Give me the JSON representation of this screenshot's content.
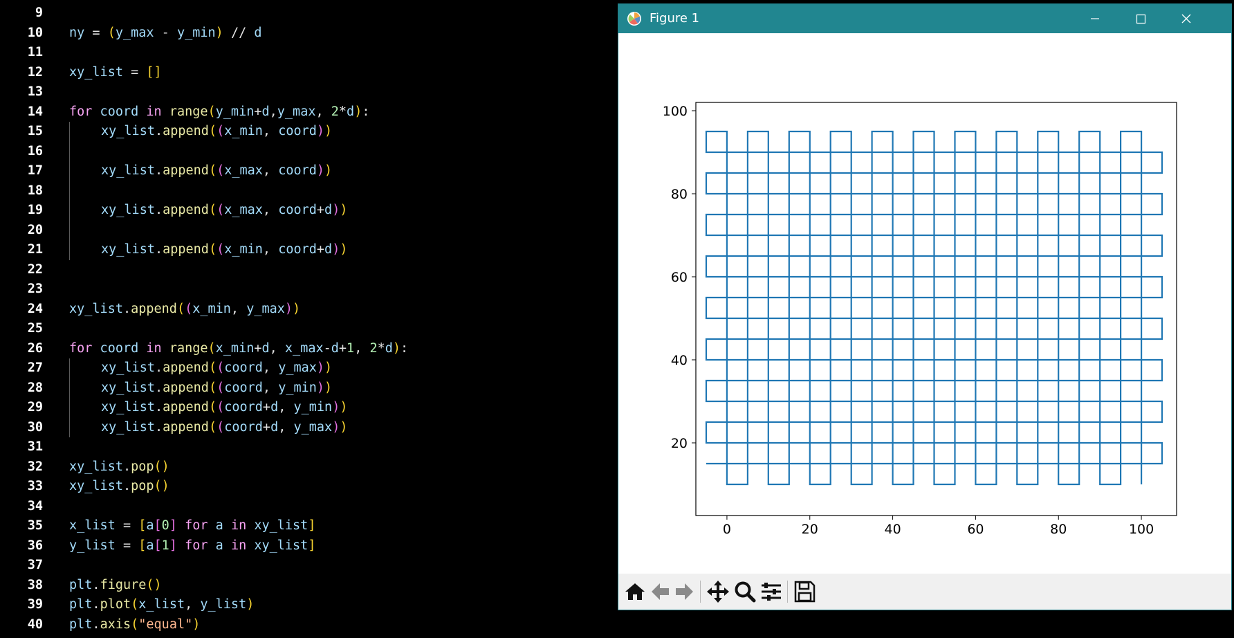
{
  "editor": {
    "lines": [
      {
        "n": "9",
        "indent": 0,
        "tokens": []
      },
      {
        "n": "10",
        "indent": 0,
        "tokens": [
          [
            "ny",
            "var"
          ],
          [
            " = ",
            "op"
          ],
          [
            "(",
            "p1"
          ],
          [
            "y_max",
            "var"
          ],
          [
            " - ",
            "op"
          ],
          [
            "y_min",
            "var"
          ],
          [
            ")",
            "p1"
          ],
          [
            " // ",
            "op"
          ],
          [
            "d",
            "var"
          ]
        ]
      },
      {
        "n": "11",
        "indent": 0,
        "tokens": []
      },
      {
        "n": "12",
        "indent": 0,
        "tokens": [
          [
            "xy_list",
            "var"
          ],
          [
            " = ",
            "op"
          ],
          [
            "[]",
            "p1"
          ]
        ]
      },
      {
        "n": "13",
        "indent": 0,
        "tokens": []
      },
      {
        "n": "14",
        "indent": 0,
        "tokens": [
          [
            "for",
            "kw"
          ],
          [
            " coord ",
            "var"
          ],
          [
            "in",
            "kw"
          ],
          [
            " ",
            "op"
          ],
          [
            "range",
            "fn"
          ],
          [
            "(",
            "p1"
          ],
          [
            "y_min",
            "var"
          ],
          [
            "+",
            "op"
          ],
          [
            "d",
            "var"
          ],
          [
            ",",
            "op"
          ],
          [
            "y_max",
            "var"
          ],
          [
            ", ",
            "op"
          ],
          [
            "2",
            "num"
          ],
          [
            "*",
            "op"
          ],
          [
            "d",
            "var"
          ],
          [
            ")",
            "p1"
          ],
          [
            ":",
            "op"
          ]
        ]
      },
      {
        "n": "15",
        "indent": 1,
        "tokens": [
          [
            "xy_list",
            "var"
          ],
          [
            ".",
            "op"
          ],
          [
            "append",
            "fn"
          ],
          [
            "(",
            "p1"
          ],
          [
            "(",
            "p2"
          ],
          [
            "x_min",
            "var"
          ],
          [
            ", ",
            "op"
          ],
          [
            "coord",
            "var"
          ],
          [
            ")",
            "p2"
          ],
          [
            ")",
            "p1"
          ]
        ]
      },
      {
        "n": "16",
        "indent": 1,
        "tokens": []
      },
      {
        "n": "17",
        "indent": 1,
        "tokens": [
          [
            "xy_list",
            "var"
          ],
          [
            ".",
            "op"
          ],
          [
            "append",
            "fn"
          ],
          [
            "(",
            "p1"
          ],
          [
            "(",
            "p2"
          ],
          [
            "x_max",
            "var"
          ],
          [
            ", ",
            "op"
          ],
          [
            "coord",
            "var"
          ],
          [
            ")",
            "p2"
          ],
          [
            ")",
            "p1"
          ]
        ]
      },
      {
        "n": "18",
        "indent": 1,
        "tokens": []
      },
      {
        "n": "19",
        "indent": 1,
        "tokens": [
          [
            "xy_list",
            "var"
          ],
          [
            ".",
            "op"
          ],
          [
            "append",
            "fn"
          ],
          [
            "(",
            "p1"
          ],
          [
            "(",
            "p2"
          ],
          [
            "x_max",
            "var"
          ],
          [
            ", ",
            "op"
          ],
          [
            "coord",
            "var"
          ],
          [
            "+",
            "op"
          ],
          [
            "d",
            "var"
          ],
          [
            ")",
            "p2"
          ],
          [
            ")",
            "p1"
          ]
        ]
      },
      {
        "n": "20",
        "indent": 1,
        "tokens": []
      },
      {
        "n": "21",
        "indent": 1,
        "tokens": [
          [
            "xy_list",
            "var"
          ],
          [
            ".",
            "op"
          ],
          [
            "append",
            "fn"
          ],
          [
            "(",
            "p1"
          ],
          [
            "(",
            "p2"
          ],
          [
            "x_min",
            "var"
          ],
          [
            ", ",
            "op"
          ],
          [
            "coord",
            "var"
          ],
          [
            "+",
            "op"
          ],
          [
            "d",
            "var"
          ],
          [
            ")",
            "p2"
          ],
          [
            ")",
            "p1"
          ]
        ]
      },
      {
        "n": "22",
        "indent": 0,
        "tokens": []
      },
      {
        "n": "23",
        "indent": 0,
        "tokens": []
      },
      {
        "n": "24",
        "indent": 0,
        "tokens": [
          [
            "xy_list",
            "var"
          ],
          [
            ".",
            "op"
          ],
          [
            "append",
            "fn"
          ],
          [
            "(",
            "p1"
          ],
          [
            "(",
            "p2"
          ],
          [
            "x_min",
            "var"
          ],
          [
            ", ",
            "op"
          ],
          [
            "y_max",
            "var"
          ],
          [
            ")",
            "p2"
          ],
          [
            ")",
            "p1"
          ]
        ]
      },
      {
        "n": "25",
        "indent": 0,
        "tokens": []
      },
      {
        "n": "26",
        "indent": 0,
        "tokens": [
          [
            "for",
            "kw"
          ],
          [
            " coord ",
            "var"
          ],
          [
            "in",
            "kw"
          ],
          [
            " ",
            "op"
          ],
          [
            "range",
            "fn"
          ],
          [
            "(",
            "p1"
          ],
          [
            "x_min",
            "var"
          ],
          [
            "+",
            "op"
          ],
          [
            "d",
            "var"
          ],
          [
            ", ",
            "op"
          ],
          [
            "x_max",
            "var"
          ],
          [
            "-",
            "op"
          ],
          [
            "d",
            "var"
          ],
          [
            "+",
            "op"
          ],
          [
            "1",
            "num"
          ],
          [
            ", ",
            "op"
          ],
          [
            "2",
            "num"
          ],
          [
            "*",
            "op"
          ],
          [
            "d",
            "var"
          ],
          [
            ")",
            "p1"
          ],
          [
            ":",
            "op"
          ]
        ]
      },
      {
        "n": "27",
        "indent": 1,
        "tokens": [
          [
            "xy_list",
            "var"
          ],
          [
            ".",
            "op"
          ],
          [
            "append",
            "fn"
          ],
          [
            "(",
            "p1"
          ],
          [
            "(",
            "p2"
          ],
          [
            "coord",
            "var"
          ],
          [
            ", ",
            "op"
          ],
          [
            "y_max",
            "var"
          ],
          [
            ")",
            "p2"
          ],
          [
            ")",
            "p1"
          ]
        ]
      },
      {
        "n": "28",
        "indent": 1,
        "tokens": [
          [
            "xy_list",
            "var"
          ],
          [
            ".",
            "op"
          ],
          [
            "append",
            "fn"
          ],
          [
            "(",
            "p1"
          ],
          [
            "(",
            "p2"
          ],
          [
            "coord",
            "var"
          ],
          [
            ", ",
            "op"
          ],
          [
            "y_min",
            "var"
          ],
          [
            ")",
            "p2"
          ],
          [
            ")",
            "p1"
          ]
        ]
      },
      {
        "n": "29",
        "indent": 1,
        "tokens": [
          [
            "xy_list",
            "var"
          ],
          [
            ".",
            "op"
          ],
          [
            "append",
            "fn"
          ],
          [
            "(",
            "p1"
          ],
          [
            "(",
            "p2"
          ],
          [
            "coord",
            "var"
          ],
          [
            "+",
            "op"
          ],
          [
            "d",
            "var"
          ],
          [
            ", ",
            "op"
          ],
          [
            "y_min",
            "var"
          ],
          [
            ")",
            "p2"
          ],
          [
            ")",
            "p1"
          ]
        ]
      },
      {
        "n": "30",
        "indent": 1,
        "tokens": [
          [
            "xy_list",
            "var"
          ],
          [
            ".",
            "op"
          ],
          [
            "append",
            "fn"
          ],
          [
            "(",
            "p1"
          ],
          [
            "(",
            "p2"
          ],
          [
            "coord",
            "var"
          ],
          [
            "+",
            "op"
          ],
          [
            "d",
            "var"
          ],
          [
            ", ",
            "op"
          ],
          [
            "y_max",
            "var"
          ],
          [
            ")",
            "p2"
          ],
          [
            ")",
            "p1"
          ]
        ]
      },
      {
        "n": "31",
        "indent": 0,
        "tokens": []
      },
      {
        "n": "32",
        "indent": 0,
        "tokens": [
          [
            "xy_list",
            "var"
          ],
          [
            ".",
            "op"
          ],
          [
            "pop",
            "fn"
          ],
          [
            "()",
            "p1"
          ]
        ]
      },
      {
        "n": "33",
        "indent": 0,
        "tokens": [
          [
            "xy_list",
            "var"
          ],
          [
            ".",
            "op"
          ],
          [
            "pop",
            "fn"
          ],
          [
            "()",
            "p1"
          ]
        ]
      },
      {
        "n": "34",
        "indent": 0,
        "tokens": []
      },
      {
        "n": "35",
        "indent": 0,
        "tokens": [
          [
            "x_list",
            "var"
          ],
          [
            " = ",
            "op"
          ],
          [
            "[",
            "p1"
          ],
          [
            "a",
            "var"
          ],
          [
            "[",
            "p2"
          ],
          [
            "0",
            "num"
          ],
          [
            "]",
            "p2"
          ],
          [
            " for ",
            "kw"
          ],
          [
            "a ",
            "var"
          ],
          [
            "in",
            "kw"
          ],
          [
            " xy_list",
            "var"
          ],
          [
            "]",
            "p1"
          ]
        ]
      },
      {
        "n": "36",
        "indent": 0,
        "tokens": [
          [
            "y_list",
            "var"
          ],
          [
            " = ",
            "op"
          ],
          [
            "[",
            "p1"
          ],
          [
            "a",
            "var"
          ],
          [
            "[",
            "p2"
          ],
          [
            "1",
            "num"
          ],
          [
            "]",
            "p2"
          ],
          [
            " for ",
            "kw"
          ],
          [
            "a ",
            "var"
          ],
          [
            "in",
            "kw"
          ],
          [
            " xy_list",
            "var"
          ],
          [
            "]",
            "p1"
          ]
        ]
      },
      {
        "n": "37",
        "indent": 0,
        "tokens": []
      },
      {
        "n": "38",
        "indent": 0,
        "tokens": [
          [
            "plt",
            "var"
          ],
          [
            ".",
            "op"
          ],
          [
            "figure",
            "fn"
          ],
          [
            "()",
            "p1"
          ]
        ]
      },
      {
        "n": "39",
        "indent": 0,
        "tokens": [
          [
            "plt",
            "var"
          ],
          [
            ".",
            "op"
          ],
          [
            "plot",
            "fn"
          ],
          [
            "(",
            "p1"
          ],
          [
            "x_list",
            "var"
          ],
          [
            ", ",
            "op"
          ],
          [
            "y_list",
            "var"
          ],
          [
            ")",
            "p1"
          ]
        ]
      },
      {
        "n": "40",
        "indent": 0,
        "tokens": [
          [
            "plt",
            "var"
          ],
          [
            ".",
            "op"
          ],
          [
            "axis",
            "fn"
          ],
          [
            "(",
            "p1"
          ],
          [
            "\"equal\"",
            "str"
          ],
          [
            ")",
            "p1"
          ]
        ]
      }
    ]
  },
  "window": {
    "title": "Figure 1",
    "icons": {
      "app": "matplotlib-logo-icon",
      "minimize": "minimize-icon",
      "maximize": "maximize-icon",
      "close": "close-icon"
    },
    "colors": {
      "titlebar": "#218690",
      "plot_line": "#1f77b4"
    }
  },
  "toolbar": {
    "buttons": [
      "home-icon",
      "back-arrow-icon",
      "forward-arrow-icon",
      "pan-icon",
      "zoom-icon",
      "configure-subplots-icon",
      "save-icon"
    ]
  },
  "chart_data": {
    "type": "line",
    "series": [
      {
        "description_values": "raster path",
        "x_min": -5,
        "x_max": 105,
        "y_min": 10,
        "y_max": 95,
        "d": 5
      }
    ],
    "xlim": [
      -7.5,
      108.5
    ],
    "ylim": [
      2.5,
      102
    ],
    "x_ticks": [
      "0",
      "20",
      "40",
      "60",
      "80",
      "100"
    ],
    "y_ticks": [
      "20",
      "40",
      "60",
      "80",
      "100"
    ],
    "x_tick_values": [
      0,
      20,
      40,
      60,
      80,
      100
    ],
    "y_tick_values": [
      20,
      40,
      60,
      80,
      100
    ]
  }
}
